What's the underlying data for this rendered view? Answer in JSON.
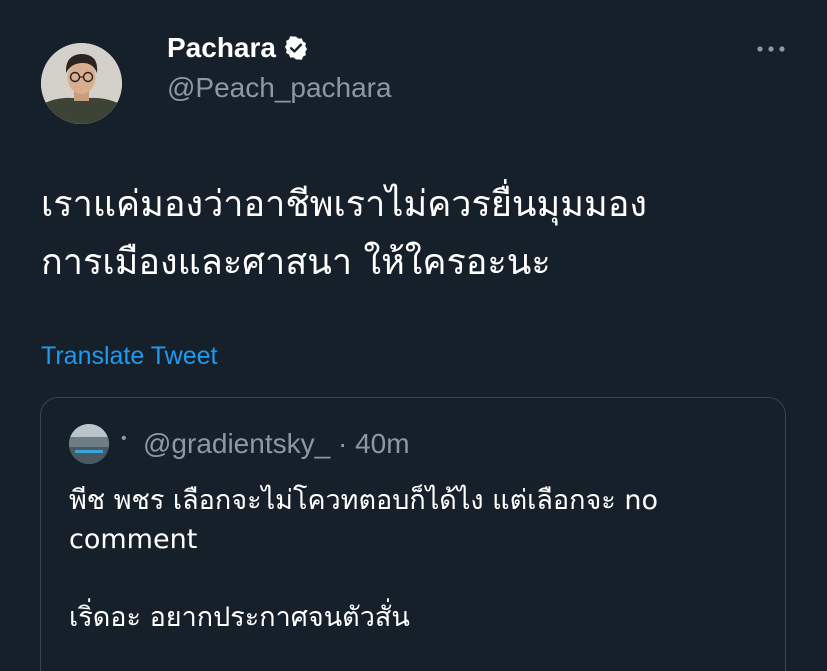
{
  "author": {
    "display_name": "Pachara",
    "handle": "@Peach_pachara",
    "verified": true
  },
  "tweet": {
    "text": "เราแค่มองว่าอาชีพเราไม่ควรยื่นมุมมอง\nการเมืองและศาสนา ให้ใครอะนะ",
    "translate_label": "Translate Tweet"
  },
  "quoted": {
    "separator": "•",
    "meta": "@gradientsky_ · 40m",
    "text": "พีช พชร เลือกจะไม่โควทตอบก็ได้ไง แต่เลือกจะ no\ncomment\n\nเริ่ดอะ อยากประกาศจนตัวสั่น"
  },
  "icons": {
    "verified": "verified-badge-icon",
    "more": "more-options-icon"
  },
  "colors": {
    "background": "#15202b",
    "accent": "#1d9bf0",
    "secondary_text": "#8b98a5",
    "border": "#38444d"
  }
}
